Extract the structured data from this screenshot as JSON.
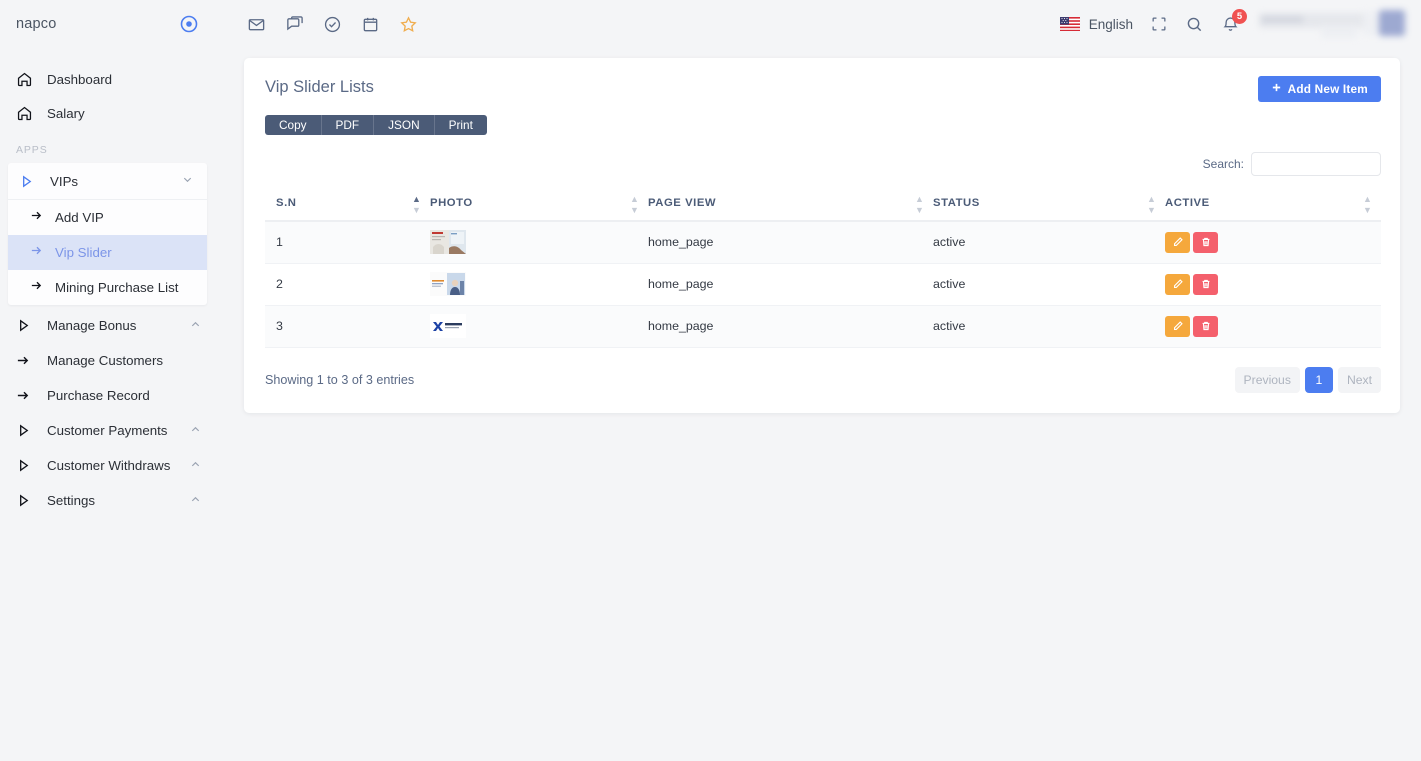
{
  "brand": {
    "name": "napco",
    "icon": "target-circle-icon"
  },
  "sidebar": {
    "top_items": [
      {
        "label": "Dashboard",
        "icon": "home-icon"
      },
      {
        "label": "Salary",
        "icon": "home-icon"
      }
    ],
    "section_label": "APPS",
    "group": {
      "label": "VIPs",
      "icon": "play-triangle-icon",
      "caret": "chevron-down-icon",
      "children": [
        {
          "label": "Add VIP",
          "icon": "arrow-right-icon",
          "active": false
        },
        {
          "label": "Vip Slider",
          "icon": "arrow-right-icon",
          "active": true
        },
        {
          "label": "Mining Purchase List",
          "icon": "arrow-right-icon",
          "active": false
        }
      ]
    },
    "lower_items": [
      {
        "label": "Manage Bonus",
        "icon": "play-triangle-icon",
        "caret": "chevron-up-icon"
      },
      {
        "label": "Manage Customers",
        "icon": "arrow-right-icon",
        "caret": ""
      },
      {
        "label": "Purchase Record",
        "icon": "arrow-right-icon",
        "caret": ""
      },
      {
        "label": "Customer Payments",
        "icon": "play-triangle-icon",
        "caret": "chevron-up-icon"
      },
      {
        "label": "Customer Withdraws",
        "icon": "play-triangle-icon",
        "caret": "chevron-up-icon"
      },
      {
        "label": "Settings",
        "icon": "play-triangle-icon",
        "caret": "chevron-up-icon"
      }
    ]
  },
  "topbar": {
    "icons": [
      "mail-icon",
      "chat-icon",
      "check-circle-icon",
      "calendar-icon",
      "star-icon"
    ],
    "language": "English",
    "flag": "us-flag-icon",
    "fullscreen_icon": "fullscreen-icon",
    "search_icon": "search-icon",
    "bell_icon": "bell-icon",
    "notification_count": "5"
  },
  "card": {
    "title": "Vip Slider Lists",
    "add_button": "Add New Item",
    "add_icon": "plus-icon",
    "export_buttons": [
      "Copy",
      "PDF",
      "JSON",
      "Print"
    ],
    "search_label": "Search:",
    "search_value": "",
    "search_placeholder": ""
  },
  "table": {
    "columns": [
      {
        "label": "S.N",
        "sort": "asc"
      },
      {
        "label": "PHOTO",
        "sort": "none"
      },
      {
        "label": "PAGE VIEW",
        "sort": "none"
      },
      {
        "label": "STATUS",
        "sort": "none"
      },
      {
        "label": "ACTIVE",
        "sort": "none"
      }
    ],
    "rows": [
      {
        "sn": "1",
        "photo": "slider-thumbnail-1",
        "page_view": "home_page",
        "status": "active",
        "edit": "edit-icon",
        "delete": "trash-icon"
      },
      {
        "sn": "2",
        "photo": "slider-thumbnail-2",
        "page_view": "home_page",
        "status": "active",
        "edit": "edit-icon",
        "delete": "trash-icon"
      },
      {
        "sn": "3",
        "photo": "slider-thumbnail-3",
        "page_view": "home_page",
        "status": "active",
        "edit": "edit-icon",
        "delete": "trash-icon"
      }
    ],
    "entries_text": "Showing 1 to 3 of 3 entries",
    "pagination": {
      "previous": "Previous",
      "page": "1",
      "next": "Next"
    }
  },
  "colors": {
    "accent_blue": "#4c7df0",
    "export_dark": "#4b5b77",
    "edit_orange": "#f5a83c",
    "delete_red": "#f4606c",
    "badge_red": "#f05252",
    "active_nav_bg": "#dbe3f7",
    "active_nav_text": "#7c95e8",
    "page_bg": "#f4f5f7"
  }
}
